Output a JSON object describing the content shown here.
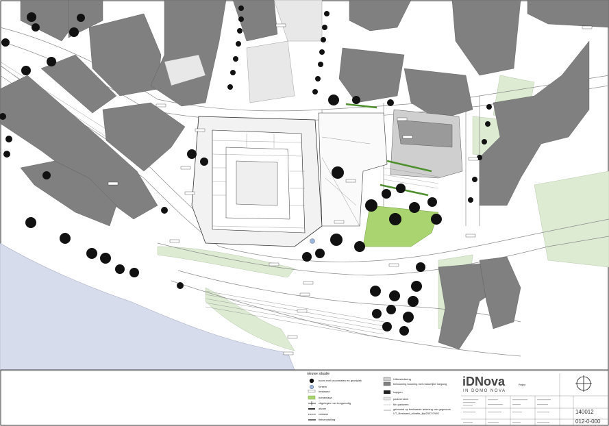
{
  "legend": {
    "heading": "nieuwe situatie",
    "items_left": [
      "boom met kroonmaten en groeiplek",
      "fontein",
      "bestaand",
      "bomenlaan",
      "zitgelegen met borgsnodig",
      "afvoer",
      "reclame",
      "fietsenstalling"
    ],
    "items_right": [
      "Uitbestedering",
      "bebouwing bouwing met natuurlijke toegang",
      "trappen",
      "parkeerstrek",
      "Mn parkeren",
      "gebouwd op bestaande tekening van gegevens",
      "UT_Bestaand_situatie_lijst2007.DWG"
    ]
  },
  "logo": {
    "name": "iDNova",
    "tagline": "IN DOMO NOVA"
  },
  "titleblock": {
    "small_label": "Project",
    "project_number": "140012",
    "drawing_number": "012-0-000"
  },
  "colors": {
    "building": "#808080",
    "green": "#a9d46f",
    "green_light": "#dcebd2",
    "water": "#d7dcec",
    "road_line": "#8a8a8a",
    "tree": "#111111"
  }
}
